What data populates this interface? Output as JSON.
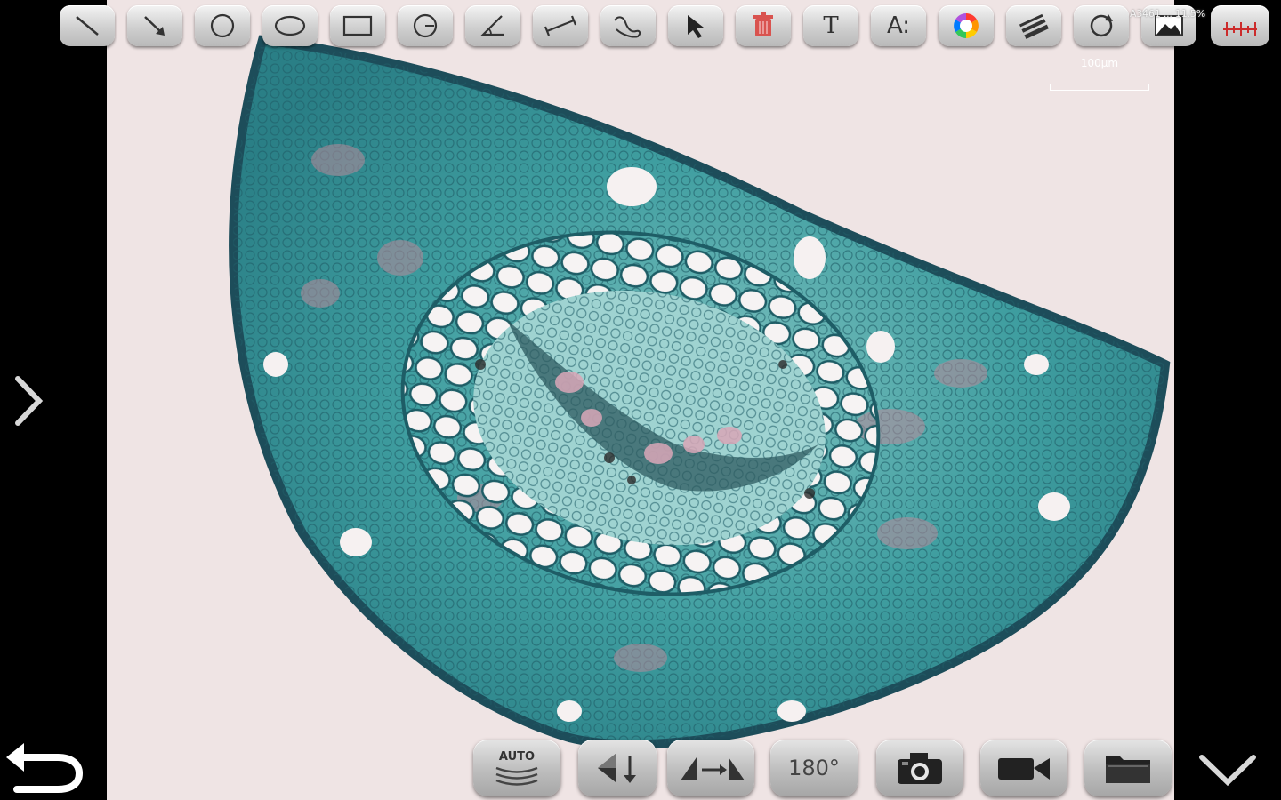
{
  "toolbar": {
    "tools": [
      {
        "name": "line-tool",
        "icon": "line-icon"
      },
      {
        "name": "arrow-tool",
        "icon": "arrow-icon"
      },
      {
        "name": "circle-tool",
        "icon": "circle-icon"
      },
      {
        "name": "ellipse-tool",
        "icon": "ellipse-icon"
      },
      {
        "name": "rectangle-tool",
        "icon": "rectangle-icon"
      },
      {
        "name": "circle-center-tool",
        "icon": "circle-center-icon"
      },
      {
        "name": "angle-tool",
        "icon": "angle-icon"
      },
      {
        "name": "measure-tool",
        "icon": "measure-icon"
      },
      {
        "name": "freehand-tool",
        "icon": "freehand-icon"
      },
      {
        "name": "select-tool",
        "icon": "cursor-icon"
      },
      {
        "name": "delete-tool",
        "icon": "trash-icon"
      },
      {
        "name": "text-tool",
        "icon": "text-icon",
        "label": "T"
      },
      {
        "name": "font-size-tool",
        "icon": "font-size-icon",
        "label": "A:"
      },
      {
        "name": "color-tool",
        "icon": "color-wheel-icon"
      },
      {
        "name": "line-width-tool",
        "icon": "line-width-icon"
      },
      {
        "name": "refresh-tool",
        "icon": "refresh-icon"
      },
      {
        "name": "image-tool",
        "icon": "image-icon"
      },
      {
        "name": "calibrate-tool",
        "icon": "ruler-icon"
      }
    ]
  },
  "status_text": "A3461  ...  11.5%",
  "scale_label": "100μm",
  "bottom": {
    "auto_label": "AUTO",
    "rotate_label": "180°"
  },
  "colors": {
    "background": "#000000",
    "viewport": "#efe4e4",
    "stain_teal": "#2f8f91",
    "stain_dark": "#1d4d5a",
    "stain_pink": "#b88a9a",
    "delete_red": "#d9534f"
  }
}
